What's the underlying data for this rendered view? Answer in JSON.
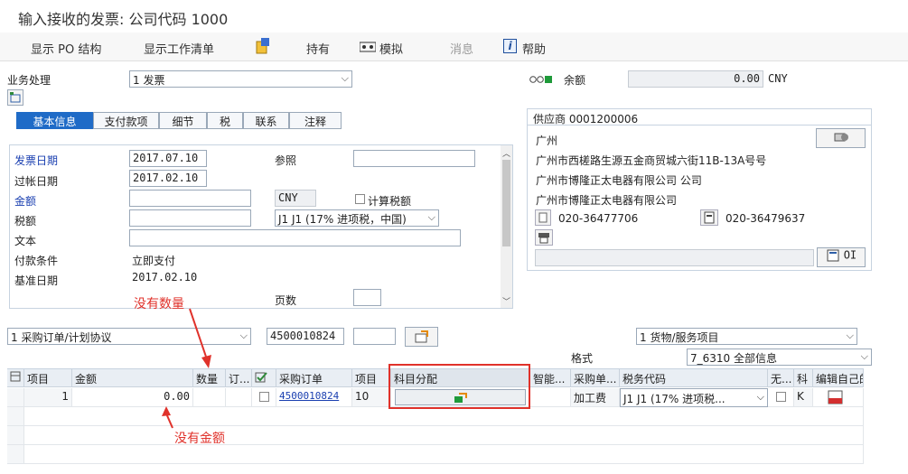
{
  "window": {
    "title": "输入接收的发票: 公司代码 1000"
  },
  "toolbar": {
    "show_po": "显示 PO 结构",
    "show_worklist": "显示工作清单",
    "hold": "持有",
    "simulate": "模拟",
    "messages": "消息",
    "help": "帮助"
  },
  "header": {
    "business_label": "业务处理",
    "business_value": "1 发票",
    "balance_label": "余额",
    "balance_value": "0.00",
    "currency": "CNY"
  },
  "tabs": [
    "基本信息",
    "支付款项",
    "细节",
    "税",
    "联系",
    "注释"
  ],
  "basic": {
    "invoice_date_label": "发票日期",
    "invoice_date": "2017.07.10",
    "posting_date_label": "过帐日期",
    "posting_date": "2017.02.10",
    "amount_label": "金额",
    "amount_value": "",
    "amount_currency": "CNY",
    "calc_tax_label": "计算税额",
    "tax_label": "税额",
    "tax_code": "J1 J1 (17% 进项税，中国)",
    "text_label": "文本",
    "payment_terms_label": "付款条件",
    "payment_terms_value": "立即支付",
    "baseline_date_label": "基准日期",
    "baseline_date": "2017.02.10",
    "reference_label": "参照",
    "page_label": "页数"
  },
  "vendor": {
    "title": "供应商 0001200006",
    "city": "广州",
    "address": "广州市西槎路生源五金商贸城六街11B-13A号号",
    "name1": "广州市博隆正太电器有限公司 公司",
    "name2": "广州市博隆正太电器有限公司",
    "phone": "020-36477706",
    "fax": "020-36479637",
    "oi_label": "OI"
  },
  "reference": {
    "type": "1 采购订单/计划协议",
    "po_number": "4500010824",
    "item_type": "1 货物/服务项目",
    "layout_label": "格式",
    "layout_value": "7_6310 全部信息"
  },
  "table": {
    "headers": [
      "项目",
      "金额",
      "数量",
      "订...",
      "",
      "采购订单",
      "项目",
      "科目分配",
      "智能...",
      "采购单...",
      "税务代码",
      "无...",
      "科",
      "编辑自己的"
    ],
    "row": {
      "item": "1",
      "amount": "0.00",
      "po": "4500010824",
      "po_item": "10",
      "unit": "加工费",
      "tax": "J1 J1 (17% 进项税...",
      "k": "K"
    }
  },
  "annotations": {
    "no_quantity": "没有数量",
    "no_amount": "没有金额"
  },
  "colors": {
    "accent": "#1f6bc7",
    "annotation": "#e0322b"
  }
}
